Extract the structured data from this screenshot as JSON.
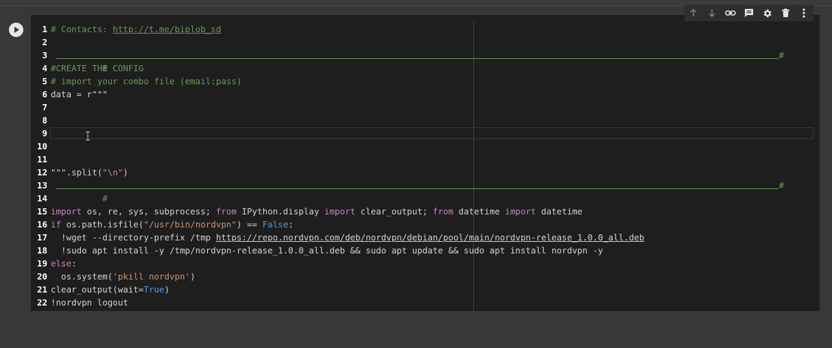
{
  "toolbar": {
    "icons": [
      "arrow-up-icon",
      "arrow-down-icon",
      "link-icon",
      "comment-icon",
      "gear-icon",
      "trash-icon",
      "more-vert-icon"
    ]
  },
  "code": {
    "lines": [
      {
        "n": "1",
        "t": "# Contacts: ",
        "link": "http://t.me/biplob_sd"
      },
      {
        "n": "2"
      },
      {
        "n": "3",
        "sep": true,
        "a": "#",
        "b": "#"
      },
      {
        "n": "4",
        "t": "#CREATE THE CONFIG"
      },
      {
        "n": "5",
        "t": "# import your combo file (email:pass)"
      },
      {
        "n": "6",
        "t": "data = r\"\"\""
      },
      {
        "n": "7"
      },
      {
        "n": "8"
      },
      {
        "n": "9"
      },
      {
        "n": "10"
      },
      {
        "n": "11"
      },
      {
        "n": "12",
        "a": "\"\"\".split(",
        "b": "\"\\n\"",
        "c": ")"
      },
      {
        "n": "13",
        "sep": true,
        "a": "#",
        "b": "#"
      },
      {
        "n": "14"
      },
      {
        "n": "15",
        "k1": "import",
        "t1": " os, re, sys, subprocess; ",
        "k2": "from",
        "t2": " IPython.display ",
        "k3": "import",
        "t3": " clear_output; ",
        "k4": "from",
        "t4": " datetime ",
        "k5": "import",
        "t5": " datetime"
      },
      {
        "n": "16",
        "k1": "if",
        "t1": " os.path.isfile(",
        "s1": "\"/usr/bin/nordvpn\"",
        "t2": ") == ",
        "b1": "False",
        "t3": ":"
      },
      {
        "n": "17",
        "t": "  !wget --directory-prefix /tmp ",
        "url": "https://repo.nordvpn.com/deb/nordvpn/debian/pool/main/nordvpn-release_1.0.0_all.deb"
      },
      {
        "n": "18",
        "t": "  !sudo apt install -y /tmp/nordvpn-release_1.0.0_all.deb && sudo apt update && sudo apt install nordvpn -y"
      },
      {
        "n": "19",
        "k1": "else",
        "t1": ":"
      },
      {
        "n": "20",
        "t1": "  os.system(",
        "s1": "'pkill nordvpn'",
        "t2": ")"
      },
      {
        "n": "21",
        "t1": "clear_output(wait=",
        "b1": "True",
        "t2": ")"
      },
      {
        "n": "22",
        "t": "!nordvpn logout"
      }
    ]
  }
}
